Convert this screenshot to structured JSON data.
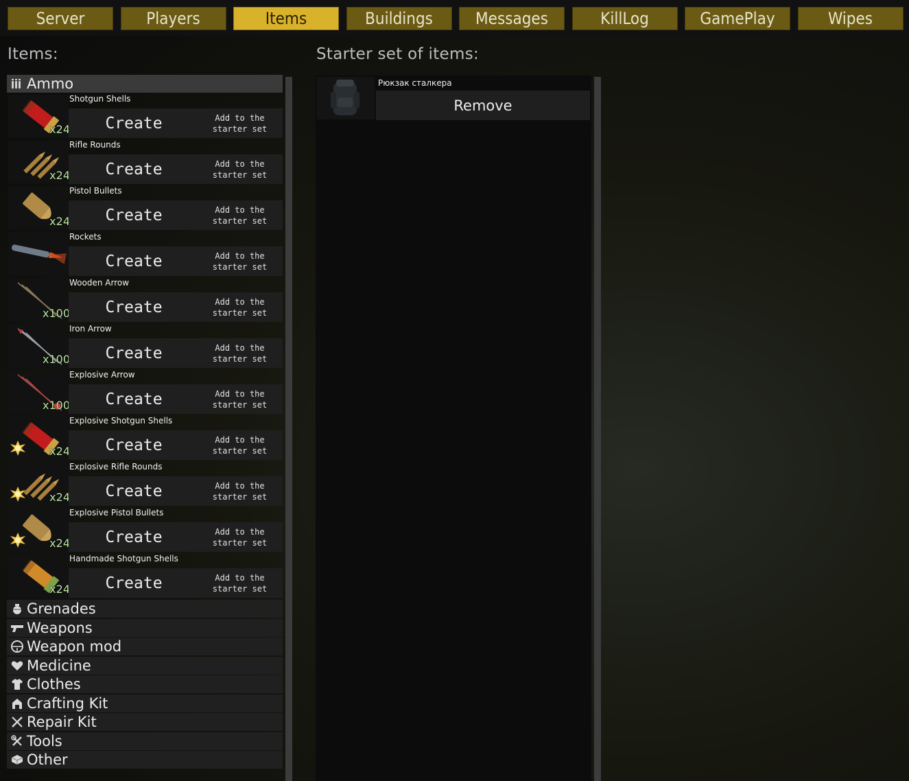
{
  "tabs": [
    {
      "label": "Server",
      "active": false
    },
    {
      "label": "Players",
      "active": false
    },
    {
      "label": "Items",
      "active": true
    },
    {
      "label": "Buildings",
      "active": false
    },
    {
      "label": "Messages",
      "active": false
    },
    {
      "label": "KillLog",
      "active": false
    },
    {
      "label": "GamePlay",
      "active": false
    },
    {
      "label": "Wipes",
      "active": false
    }
  ],
  "items_panel": {
    "title": "Items:",
    "open_category": {
      "label": "Ammo",
      "icon": "ammo-icon"
    },
    "create_label": "Create",
    "add_label_line1": "Add to the",
    "add_label_line2": "starter set",
    "items": [
      {
        "name": "Shotgun Shells",
        "qty": "x24",
        "icon": "shotgun-shell-icon"
      },
      {
        "name": "Rifle Rounds",
        "qty": "x24",
        "icon": "rifle-rounds-icon"
      },
      {
        "name": "Pistol Bullets",
        "qty": "x24",
        "icon": "pistol-bullet-icon"
      },
      {
        "name": "Rockets",
        "qty": "",
        "icon": "rocket-icon"
      },
      {
        "name": "Wooden Arrow",
        "qty": "x100",
        "icon": "wooden-arrow-icon"
      },
      {
        "name": "Iron Arrow",
        "qty": "x100",
        "icon": "iron-arrow-icon"
      },
      {
        "name": "Explosive Arrow",
        "qty": "x100",
        "icon": "explosive-arrow-icon"
      },
      {
        "name": "Explosive Shotgun Shells",
        "qty": "x24",
        "icon": "explosive-shotgun-shell-icon"
      },
      {
        "name": "Explosive Rifle Rounds",
        "qty": "x24",
        "icon": "explosive-rifle-rounds-icon"
      },
      {
        "name": "Explosive Pistol Bullets",
        "qty": "x24",
        "icon": "explosive-pistol-bullet-icon"
      },
      {
        "name": "Handmade Shotgun Shells",
        "qty": "x24",
        "icon": "handmade-shotgun-shell-icon"
      }
    ],
    "categories": [
      {
        "label": "Grenades",
        "icon": "grenade-icon"
      },
      {
        "label": "Weapons",
        "icon": "pistol-icon"
      },
      {
        "label": "Weapon mod",
        "icon": "scope-icon"
      },
      {
        "label": "Medicine",
        "icon": "heart-icon"
      },
      {
        "label": "Clothes",
        "icon": "shirt-icon"
      },
      {
        "label": "Crafting Kit",
        "icon": "workbench-icon"
      },
      {
        "label": "Repair Kit",
        "icon": "wrench-icon"
      },
      {
        "label": "Tools",
        "icon": "tools-icon"
      },
      {
        "label": "Other",
        "icon": "box-icon"
      }
    ]
  },
  "starter_panel": {
    "title": "Starter set of items:",
    "items": [
      {
        "name": "Рюкзак сталкера",
        "icon": "backpack-icon",
        "remove_label": "Remove"
      }
    ]
  },
  "colors": {
    "tab_bg": "#6a5a13",
    "tab_active_bg": "#d9b22c",
    "qty_text": "#b9e4a0"
  }
}
